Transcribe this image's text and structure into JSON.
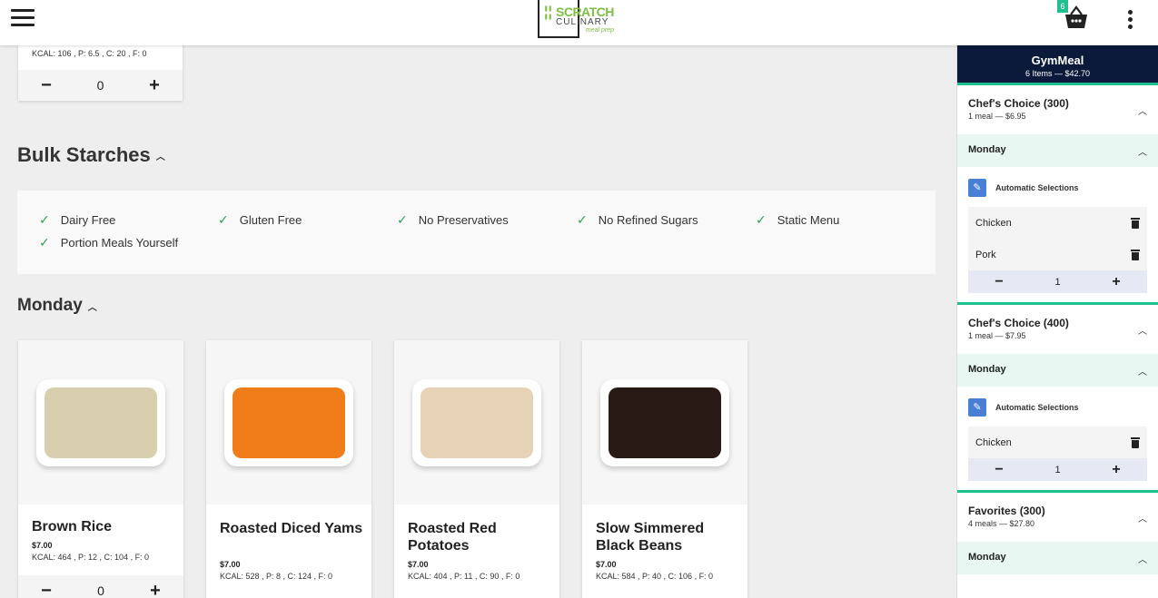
{
  "header": {
    "logo": {
      "line1": "SCRATCH",
      "line2": "CULINARY",
      "line3": "meal prep"
    },
    "cart_count": "6",
    "icons": [
      "menu-icon",
      "basket-icon",
      "more-vertical-icon"
    ]
  },
  "top_card": {
    "nutrition": "KCAL: 106 , P: 6.5 , C: 20 , F: 0",
    "qty": "0"
  },
  "section": {
    "title": "Bulk Starches",
    "diet_tags": [
      "Dairy Free",
      "Gluten Free",
      "No Preservatives",
      "No Refined Sugars",
      "Static Menu",
      "Portion Meals Yourself"
    ]
  },
  "day_title": "Monday",
  "items": [
    {
      "name": "Brown Rice",
      "price": "$7.00",
      "nutrition": "KCAL: 464 , P: 12 , C: 104 , F: 0",
      "qty": "0",
      "color": "#d8cfae"
    },
    {
      "name": "Roasted Diced Yams",
      "price": "$7.00",
      "nutrition": "KCAL: 528 , P: 8 , C: 124 , F: 0",
      "qty": "",
      "color": "#f07d1a"
    },
    {
      "name": "Roasted Red Potatoes",
      "price": "$7.00",
      "nutrition": "KCAL: 404 , P: 11 , C: 90 , F: 0",
      "qty": "",
      "color": "#e6d2b4"
    },
    {
      "name": "Slow Simmered Black Beans",
      "price": "$7.00",
      "nutrition": "KCAL: 584 , P: 40 , C: 106 , F: 0",
      "qty": "",
      "color": "#2a1a16"
    }
  ],
  "cart": {
    "title": "GymMeal",
    "summary": "6 Items — $42.70",
    "plans": [
      {
        "name": "Chef's Choice (300)",
        "meta": "1 meal  — $6.95",
        "day": "Monday",
        "auto_label": "Automatic Selections",
        "selections": [
          "Chicken",
          "Pork"
        ],
        "qty": "1"
      },
      {
        "name": "Chef's Choice (400)",
        "meta": "1 meal  — $7.95",
        "day": "Monday",
        "auto_label": "Automatic Selections",
        "selections": [
          "Chicken"
        ],
        "qty": "1"
      },
      {
        "name": "Favorites (300)",
        "meta": "4 meals  — $27.80",
        "day": "Monday"
      }
    ]
  }
}
